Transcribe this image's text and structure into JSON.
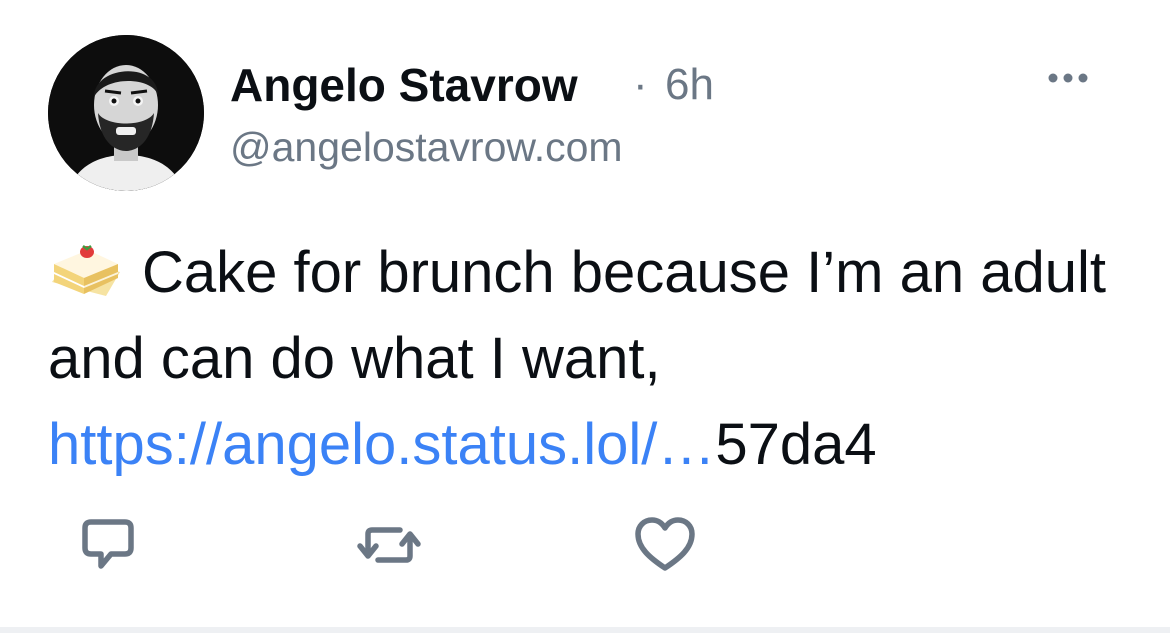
{
  "post": {
    "author_name": "Angelo Stavrow",
    "separator": "·",
    "time_ago": "6h",
    "handle": "@angelostavrow.com",
    "emoji": "cake-icon",
    "text_line": "Cake for brunch because I’m an adult and can do what I want,",
    "link_text": "https://angelo.status.lol/…",
    "link_suffix": "57da4"
  },
  "actions": {
    "reply": "reply-icon",
    "repost": "repost-icon",
    "like": "heart-icon",
    "more": "more-icon"
  },
  "colors": {
    "text": "#0b0f14",
    "muted": "#6b7785",
    "link": "#3b82f6"
  }
}
